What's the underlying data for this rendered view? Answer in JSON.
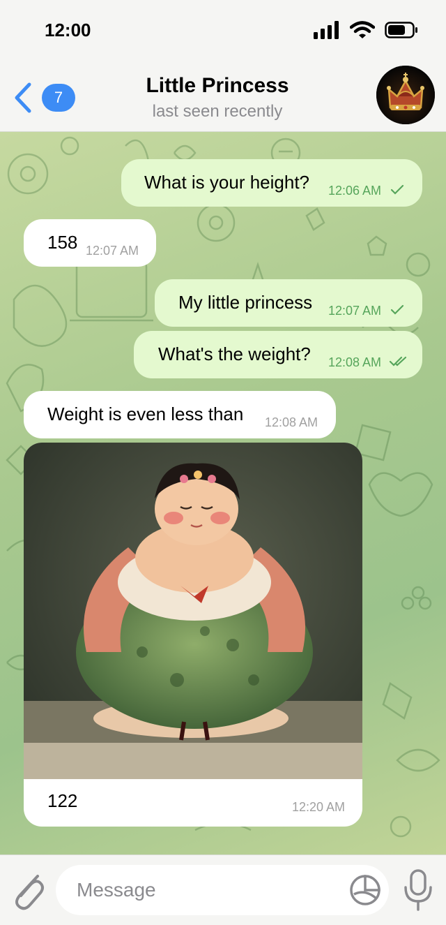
{
  "status_bar": {
    "time": "12:00"
  },
  "header": {
    "unread_count": "7",
    "title": "Little Princess",
    "subtitle": "last seen recently"
  },
  "messages": [
    {
      "direction": "outgoing",
      "text": "What is your height?",
      "time": "12:06 AM",
      "status": "sent"
    },
    {
      "direction": "incoming",
      "text": "158",
      "time": "12:07 AM"
    },
    {
      "direction": "outgoing",
      "text": "My little princess",
      "time": "12:07 AM",
      "status": "sent"
    },
    {
      "direction": "outgoing",
      "text": "What's the weight?",
      "time": "12:08 AM",
      "status": "read"
    },
    {
      "direction": "incoming",
      "text": "Weight is even less than",
      "time": "12:08 AM"
    },
    {
      "direction": "incoming",
      "type": "photo",
      "caption": "122",
      "time": "12:20 AM"
    }
  ],
  "input": {
    "placeholder": "Message"
  },
  "colors": {
    "accent": "#3d8cf5",
    "outgoing_bubble": "#e4f9cf",
    "incoming_bubble": "#ffffff",
    "outgoing_meta": "#56a55b",
    "chat_background": "#a9c98f"
  },
  "icons": [
    "back-chevron-icon",
    "paperclip-icon",
    "sticker-icon",
    "microphone-icon",
    "signal-icon",
    "wifi-icon",
    "battery-icon",
    "crown-icon"
  ]
}
